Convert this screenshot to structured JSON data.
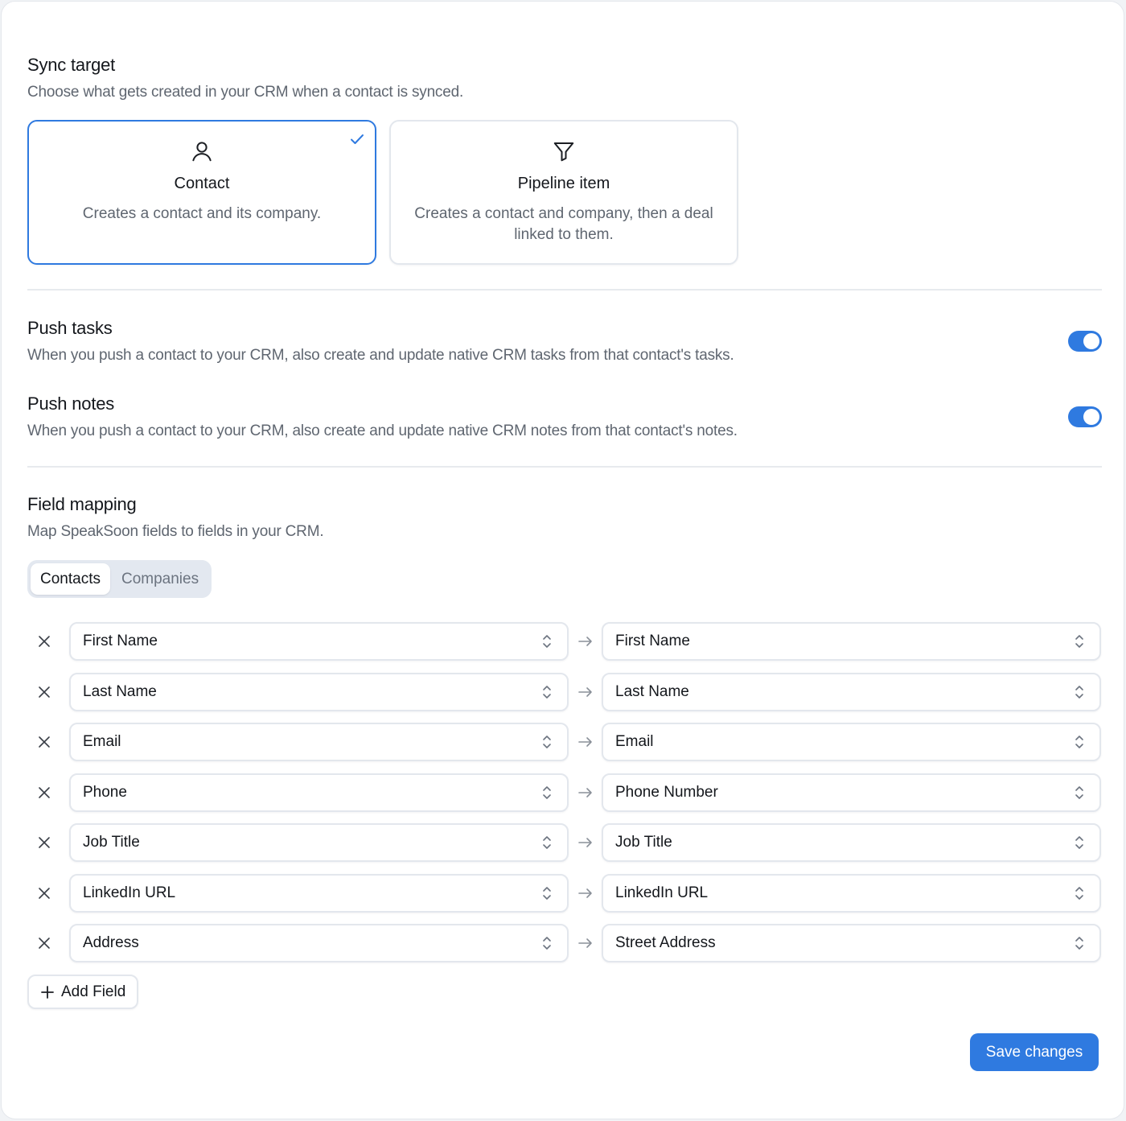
{
  "sync_target": {
    "title": "Sync target",
    "description": "Choose what gets created in your CRM when a contact is synced.",
    "options": [
      {
        "icon": "user-icon",
        "title": "Contact",
        "description": "Creates a contact and its company.",
        "selected": true
      },
      {
        "icon": "filter-icon",
        "title": "Pipeline item",
        "description": "Creates a contact and company, then a deal linked to them.",
        "selected": false
      }
    ]
  },
  "push_tasks": {
    "title": "Push tasks",
    "description": "When you push a contact to your CRM, also create and update native CRM tasks from that contact's tasks.",
    "enabled": true
  },
  "push_notes": {
    "title": "Push notes",
    "description": "When you push a contact to your CRM, also create and update native CRM notes from that contact's notes.",
    "enabled": true
  },
  "field_mapping": {
    "title": "Field mapping",
    "description": "Map SpeakSoon fields to fields in your CRM.",
    "tabs": [
      {
        "label": "Contacts",
        "active": true
      },
      {
        "label": "Companies",
        "active": false
      }
    ],
    "rows": [
      {
        "source": "First Name",
        "target": "First Name"
      },
      {
        "source": "Last Name",
        "target": "Last Name"
      },
      {
        "source": "Email",
        "target": "Email"
      },
      {
        "source": "Phone",
        "target": "Phone Number"
      },
      {
        "source": "Job Title",
        "target": "Job Title"
      },
      {
        "source": "LinkedIn URL",
        "target": "LinkedIn URL"
      },
      {
        "source": "Address",
        "target": "Street Address"
      }
    ],
    "add_label": "Add Field"
  },
  "save_label": "Save changes",
  "colors": {
    "accent": "#2f7ae0",
    "border": "#e3e7ed",
    "muted_text": "#5f6670"
  }
}
